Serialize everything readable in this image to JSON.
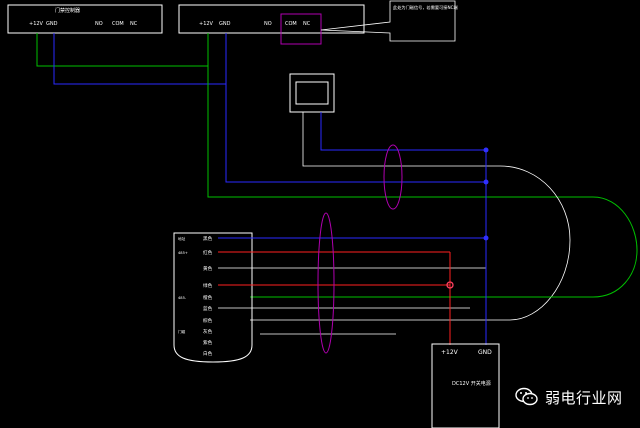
{
  "colors": {
    "background": "#000000",
    "outline": "#ffffff",
    "wire_green": "#00c000",
    "wire_blue": "#2a2aff",
    "wire_red": "#ff2020",
    "bundle_magenta": "#b000b0",
    "junction_blue": "#3030ff",
    "junction_red": "#ff4060"
  },
  "controller_left": {
    "title": "门禁控制器",
    "terminals": [
      "+12V",
      "GND",
      "NO",
      "COM",
      "NC"
    ]
  },
  "controller_right": {
    "terminals": [
      "+12V",
      "GND",
      "NO",
      "COM",
      "NC"
    ],
    "note": "此处为门磁信号，若需要可接NC端"
  },
  "reader_module": {
    "left_labels": [
      "地址",
      "485+",
      "",
      "",
      "485-",
      "",
      "",
      "门磁",
      "",
      ""
    ],
    "pin_labels": [
      "黑色",
      "红色",
      "黄色",
      "绿色",
      "橙色",
      "蓝色",
      "棕色",
      "灰色",
      "紫色",
      "白色"
    ]
  },
  "power_supply": {
    "plus_label": "+12V",
    "gnd_label": "GND",
    "name": "DC12V 开关电源"
  },
  "watermark": {
    "text": "弱电行业网",
    "icon": "wechat-icon"
  }
}
